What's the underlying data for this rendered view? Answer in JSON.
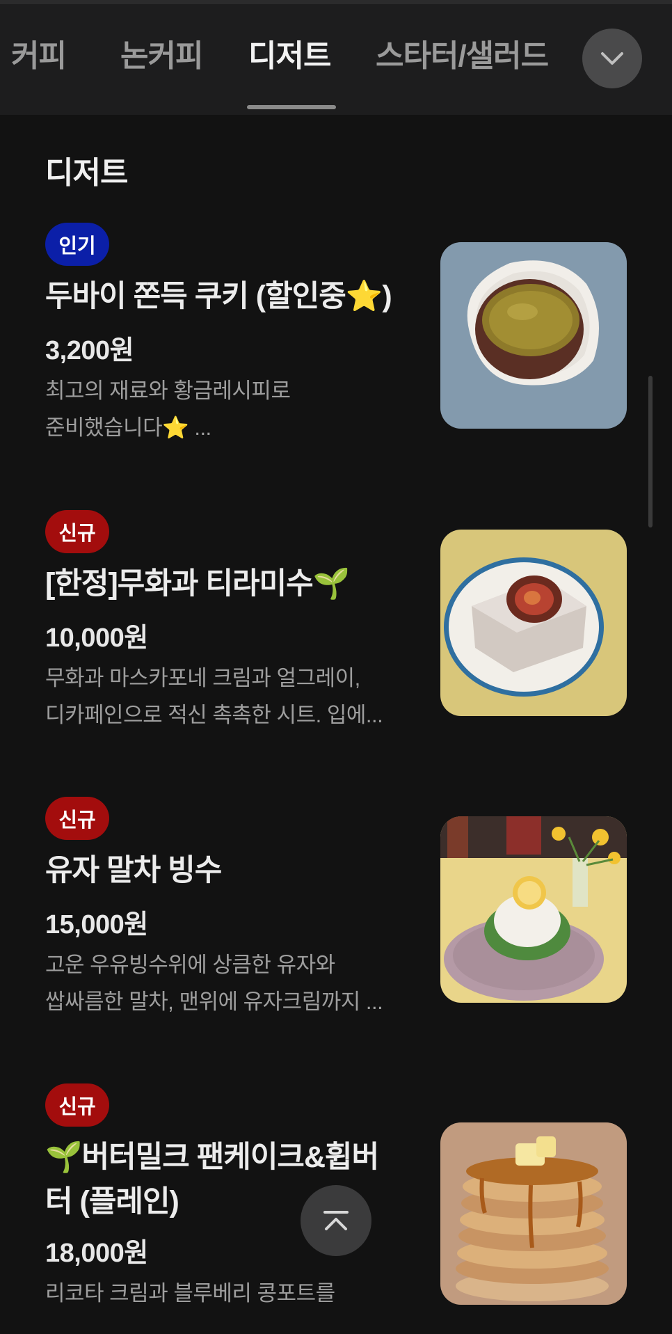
{
  "tabs": [
    {
      "label": "커피"
    },
    {
      "label": "논커피"
    },
    {
      "label": "디저트",
      "active": true
    },
    {
      "label": "스타터/샐러드"
    }
  ],
  "expand_icon": "chevron-down-icon",
  "section_title": "디저트",
  "items": [
    {
      "badge": "인기",
      "badge_color": "#0b1fa8",
      "name": "두바이 쫀득 쿠키 (할인중",
      "name_suffix": ")",
      "name_emoji": "⭐",
      "price": "3,200원",
      "desc_line1": "최고의 재료와 황금레시피로",
      "desc_line2": "준비했습니다⭐ ...",
      "image": "dubai-chewy-cookie-image"
    },
    {
      "badge": "신규",
      "badge_color": "#a30d0d",
      "name": "[한정]무화과 티라미수",
      "name_emoji": "🌱",
      "price": "10,000원",
      "desc_line1": "무화과 마스카포네 크림과 얼그레이,",
      "desc_line2": "디카페인으로 적신 촉촉한 시트. 입에...",
      "image": "fig-tiramisu-image"
    },
    {
      "badge": "신규",
      "badge_color": "#a30d0d",
      "name": "유자 말차 빙수",
      "price": "15,000원",
      "desc_line1": "고운 우유빙수위에 상큼한 유자와",
      "desc_line2": "쌉싸름한 말차, 맨위에 유자크림까지 ...",
      "image": "yuja-matcha-bingsu-image"
    },
    {
      "badge": "신규",
      "badge_color": "#a30d0d",
      "name_emoji": "🌱",
      "name_line1": "버터밀크 팬케이크&휩버",
      "name_line2": "터 (플레인)",
      "price": "18,000원",
      "desc_line1": "리코타 크림과 블루베리 콩포트를",
      "image": "buttermilk-pancake-image"
    }
  ],
  "scroll_top_icon": "arrow-up-to-top-icon"
}
